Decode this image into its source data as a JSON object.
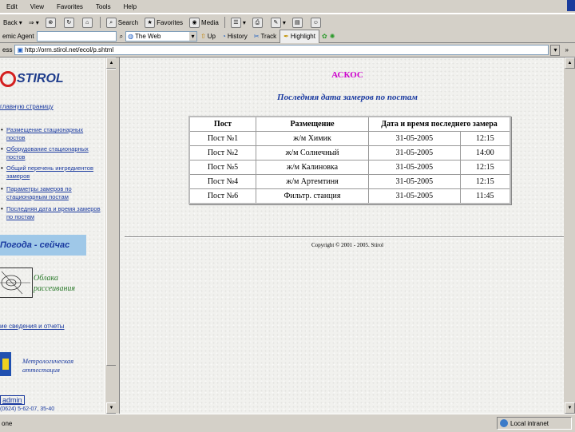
{
  "menu": [
    "Edit",
    "View",
    "Favorites",
    "Tools",
    "Help"
  ],
  "toolbar": {
    "back": "Back",
    "search": "Search",
    "favorites": "Favorites",
    "media": "Media"
  },
  "linkbar": {
    "agent_label": "emic Agent",
    "combo_value": "The Web",
    "up": "Up",
    "history": "History",
    "track": "Track",
    "highlight": "Highlight"
  },
  "address": {
    "label": "ess",
    "url": "http://orm.stirol.net/ecol/p.shtml"
  },
  "left": {
    "logo": "STIROL",
    "home_link": "главную страницу",
    "items": [
      "Размещение стационарных постов",
      "Оборудование стационарных постов",
      "Общий перечень ингредиентов замеров",
      "Параметры замеров по стационарным постам",
      "Последняя дата и время замеров по постам"
    ],
    "weather": "Погода - сейчас",
    "clouds": "Облака рассеивания",
    "reports_link": "ие сведения и отчеты",
    "metrology": "Метрологическая аттестация",
    "admin": "admin",
    "phone": "(0624) 5-62-07, 35-40"
  },
  "main": {
    "brand": "АСКОС",
    "subtitle": "Последняя дата замеров по постам",
    "headers": [
      "Пост",
      "Размещение",
      "Дата и время последнего замера"
    ],
    "rows": [
      {
        "post": "Пост №1",
        "place": "ж/м Химик",
        "date": "31-05-2005",
        "time": "12:15"
      },
      {
        "post": "Пост №2",
        "place": "ж/м Солнечный",
        "date": "31-05-2005",
        "time": "14:00"
      },
      {
        "post": "Пост №5",
        "place": "ж/м Калиновка",
        "date": "31-05-2005",
        "time": "12:15"
      },
      {
        "post": "Пост №4",
        "place": "ж/м Артемтиня",
        "date": "31-05-2005",
        "time": "12:15"
      },
      {
        "post": "Пост №6",
        "place": "Фильтр. станция",
        "date": "31-05-2005",
        "time": "11:45"
      }
    ],
    "copyright": "Copyright © 2001 - 2005. Stirol"
  },
  "status": {
    "left": "one",
    "zone": "Local intranet"
  }
}
